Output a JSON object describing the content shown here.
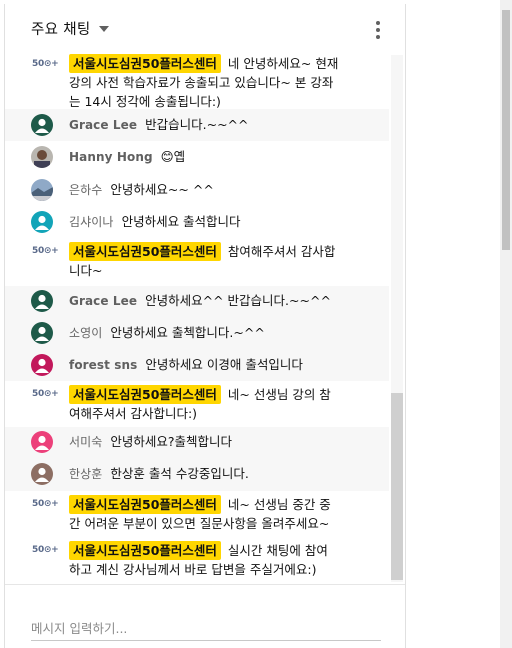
{
  "header": {
    "title": "주요 채팅",
    "caret_icon": "chevron-down-icon",
    "menu_icon": "more-vert-icon"
  },
  "owner_chip_color": "#ffd600",
  "messages": [
    {
      "type": "owner",
      "badge": "50⊙+",
      "author": "서울시도심권50플러스센터",
      "lines": [
        "네 안녕하세요~ 현재",
        "강의 사전 학습자료가 송출되고 있습니다~ 본 강좌",
        "는 14시 정각에 송출됩니다:)"
      ]
    },
    {
      "type": "user",
      "avatar": "person-icon-dark-green",
      "author": "Grace Lee",
      "text": "반갑습니다.~~^^"
    },
    {
      "type": "user",
      "avatar": "photo-avatar",
      "author": "Hanny Hong",
      "text": "😊옙"
    },
    {
      "type": "user",
      "avatar": "landscape-avatar",
      "author": "은하수",
      "text": "안녕하세요~~ ^^"
    },
    {
      "type": "user",
      "avatar": "person-icon-teal",
      "author": "김샤이나",
      "text": "안녕하세요 출석합니다"
    },
    {
      "type": "owner",
      "badge": "50⊙+",
      "author": "서울시도심권50플러스센터",
      "lines": [
        "참여해주셔서 감사합",
        "니다~"
      ]
    },
    {
      "type": "user",
      "avatar": "person-icon-dark-green",
      "author": "Grace Lee",
      "text": "안녕하세요^^ 반갑습니다.~~^^"
    },
    {
      "type": "user",
      "avatar": "person-icon-dark-green",
      "author": "소영이",
      "text": "안녕하세요 출첵합니다.~^^"
    },
    {
      "type": "user",
      "avatar": "person-icon-crimson",
      "author": "forest sns",
      "text": "안녕하세요 이경애 출석입니다"
    },
    {
      "type": "owner",
      "badge": "50⊙+",
      "author": "서울시도심권50플러스센터",
      "lines": [
        "네~ 선생님 강의 참",
        "여해주셔서 감사합니다:)"
      ]
    },
    {
      "type": "user",
      "avatar": "person-icon-pink",
      "author": "서미숙",
      "text": "안녕하세요?출첵합니다"
    },
    {
      "type": "user",
      "avatar": "person-icon-brown",
      "author": "한상훈",
      "text": "한상훈 출석 수강중입니다."
    },
    {
      "type": "owner",
      "badge": "50⊙+",
      "author": "서울시도심권50플러스센터",
      "lines": [
        "네~ 선생님 중간 중",
        "간 어려운 부분이 있으면 질문사항을 올려주세요~"
      ]
    },
    {
      "type": "owner",
      "badge": "50⊙+",
      "author": "서울시도심권50플러스센터",
      "lines": [
        "실시간 채팅에 참여",
        "하고 계신 강사님께서 바로 답변을 주실거에요:)"
      ]
    }
  ],
  "input": {
    "placeholder": "메시지 입력하기..."
  }
}
